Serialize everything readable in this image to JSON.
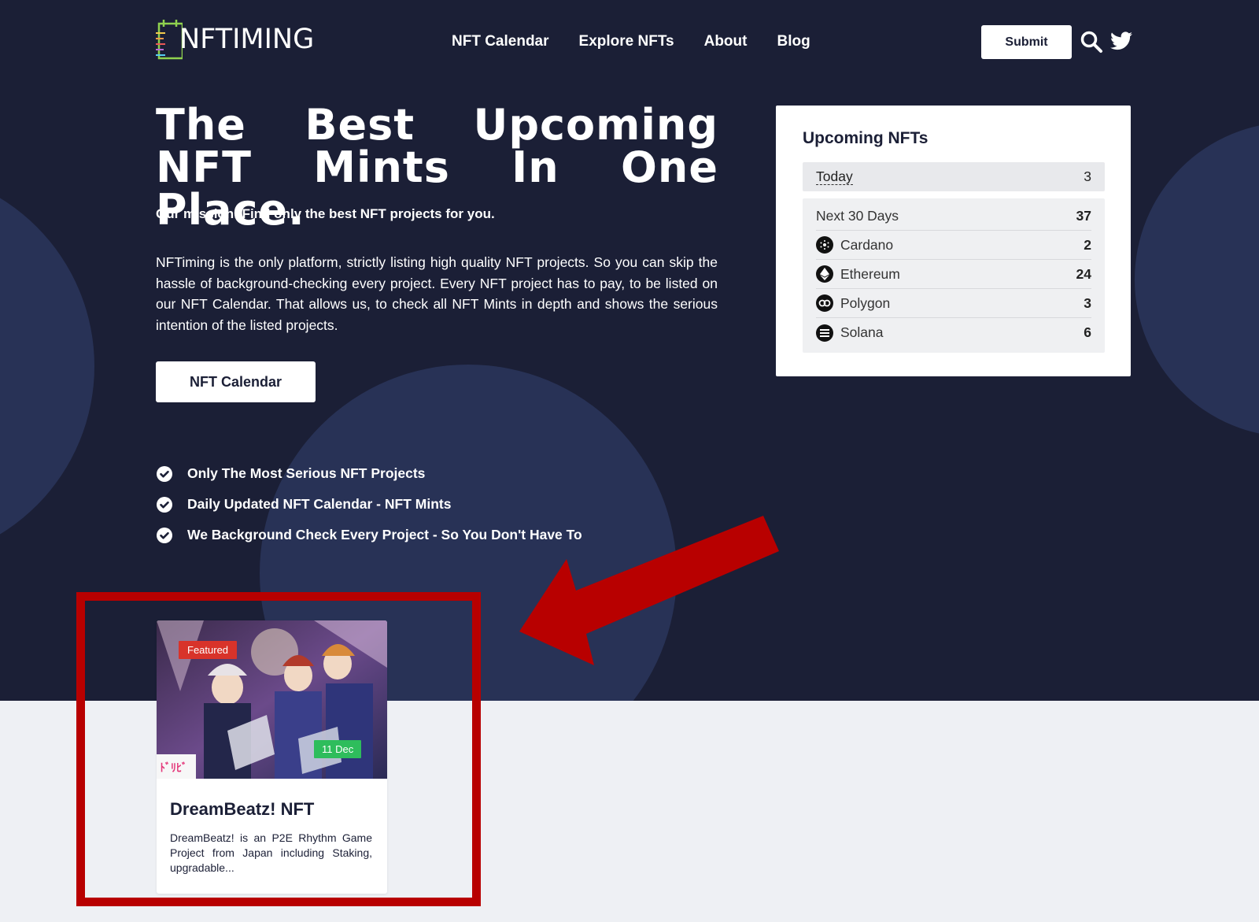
{
  "nav": {
    "logo_text": "NFTIMING",
    "links": [
      "NFT Calendar",
      "Explore NFTs",
      "About",
      "Blog"
    ],
    "submit_label": "Submit"
  },
  "hero": {
    "headline": "The Best Upcoming NFT Mints In One Place.",
    "mission": "Our mission: Find only the best NFT projects for you.",
    "description": "NFTiming is the only platform, strictly listing high quality NFT projects. So you can skip the hassle of background-checking every project. Every NFT project has to pay, to be listed on our NFT Calendar. That allows us, to check all NFT Mints in depth and shows the serious intention of the listed projects.",
    "cta_label": "NFT Calendar",
    "features": [
      "Only The Most Serious NFT Projects",
      "Daily Updated NFT Calendar - NFT Mints",
      "We Background Check Every Project - So You Don't Have To"
    ]
  },
  "upcoming": {
    "title": "Upcoming NFTs",
    "today": {
      "label": "Today",
      "count": "3"
    },
    "rows": [
      {
        "label": "Next 30 Days",
        "count": "37"
      },
      {
        "label": "Cardano",
        "count": "2",
        "icon": "cardano-icon"
      },
      {
        "label": "Ethereum",
        "count": "24",
        "icon": "ethereum-icon"
      },
      {
        "label": "Polygon",
        "count": "3",
        "icon": "polygon-icon"
      },
      {
        "label": "Solana",
        "count": "6",
        "icon": "solana-icon"
      }
    ]
  },
  "card": {
    "badge": "Featured",
    "date": "11 Dec",
    "title": "DreamBeatz! NFT",
    "description": "DreamBeatz! is an P2E Rhythm Game Project from Japan including Staking, upgradable..."
  },
  "colors": {
    "hero_bg": "#1b1f36",
    "circle": "#283256",
    "page_bg": "#eef0f4",
    "annotation_red": "#b80000",
    "featured_badge": "#d8332a",
    "date_badge": "#2ebd5c"
  }
}
